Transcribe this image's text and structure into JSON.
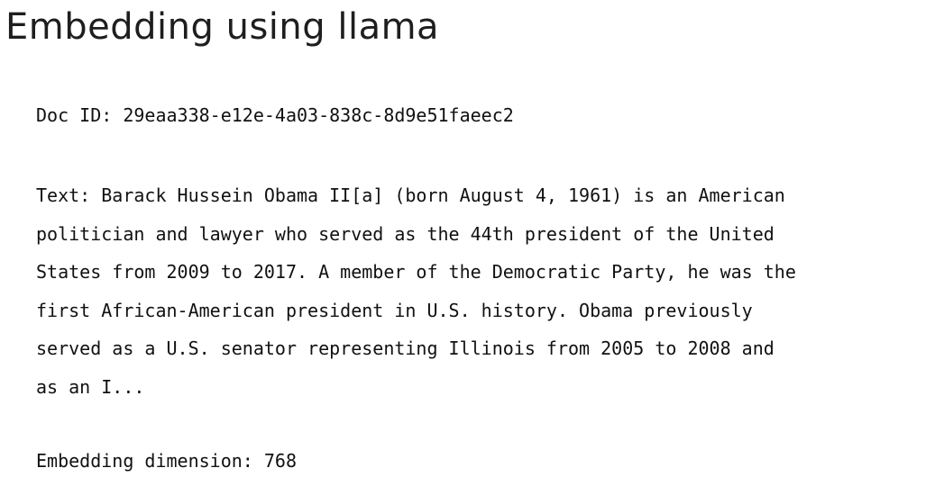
{
  "header": {
    "title": "Embedding using llama"
  },
  "output": {
    "doc_id_line": "Doc ID: 29eaa338-e12e-4a03-838c-8d9e51faeec2",
    "text_line": "Text: Barack Hussein Obama II[a] (born August 4, 1961) is an American\npolitician and lawyer who served as the 44th president of the United\nStates from 2009 to 2017. A member of the Democratic Party, he was the\nfirst African-American president in U.S. history. Obama previously\nserved as a U.S. senator representing Illinois from 2005 to 2008 and\nas an I...",
    "embedding_dimension_line": "Embedding dimension: 768"
  }
}
